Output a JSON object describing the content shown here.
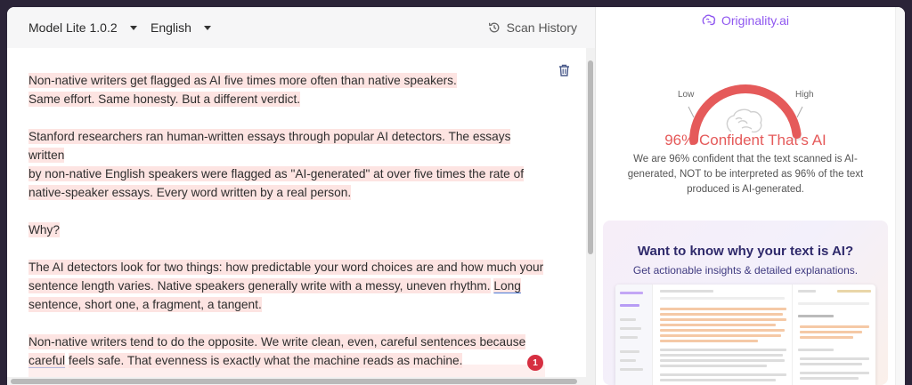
{
  "toolbar": {
    "model_label": "Model Lite 1.0.2",
    "language_label": "English",
    "scan_history_label": "Scan History"
  },
  "editor": {
    "paragraphs": [
      [
        "Non-native writers get flagged as AI five times more often than native speakers.",
        "Same effort. Same honesty. But a different verdict."
      ],
      [
        "Stanford researchers ran human-written essays through popular AI detectors. The essays written",
        "by non-native English speakers were flagged as \"AI-generated\" at over five times the rate of",
        "native-speaker essays. Every word written by a real person."
      ],
      [
        "Why?"
      ],
      [
        "The AI detectors look for two things: how predictable your word choices are and how much your",
        "sentence length varies. Native speakers generally write with a messy, uneven rhythm.",
        "sentence, short one, a fragment, a tangent."
      ],
      [
        "Non-native writers tend to do the opposite. We write clean, even, careful sentences because",
        "feels safe. That evenness is exactly what the machine reads as machine."
      ]
    ],
    "underlined_long": "Long",
    "underlined_careful": "careful",
    "notification_count": "1"
  },
  "result": {
    "brand": "Originality.ai",
    "low_label": "Low",
    "high_label": "High",
    "confidence_title": "96% Confident That's AI",
    "confidence_desc": "We are 96% confident that the text scanned is AI-generated, NOT to be interpreted as 96% of the text produced is AI-generated.",
    "confidence_value": 0.96
  },
  "promo": {
    "title": "Want to know why your text is AI?",
    "subtitle": "Get actionable insights & detailed explanations."
  },
  "colors": {
    "accent": "#8f57f0",
    "ai_red": "#e55a5a",
    "highlight": "#fde4e2",
    "badge": "#d62f41"
  }
}
